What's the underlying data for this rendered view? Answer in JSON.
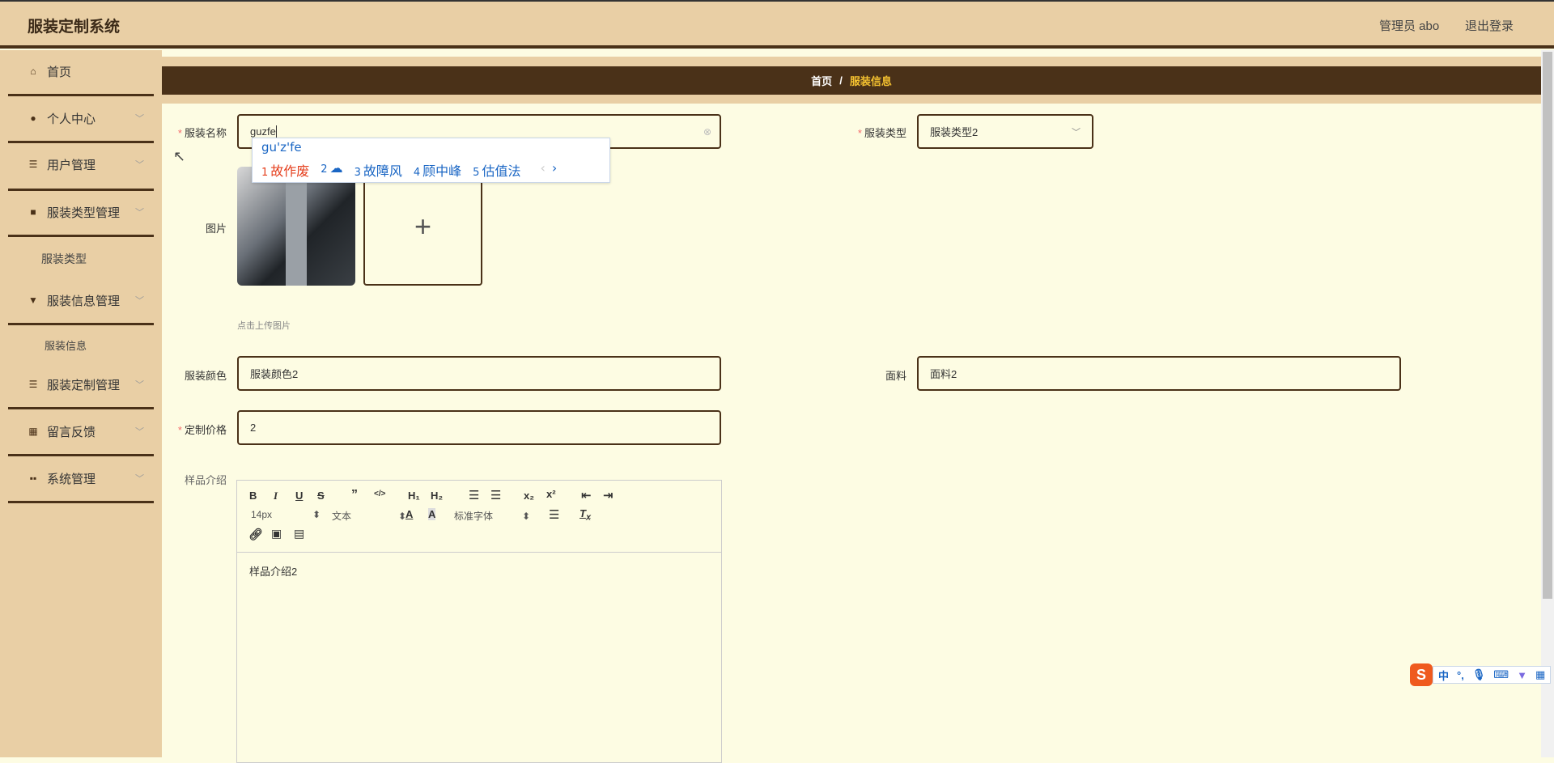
{
  "header": {
    "title": "服装定制系统",
    "user": "管理员 abo",
    "logout": "退出登录"
  },
  "sidebar": {
    "items": [
      {
        "label": "首页",
        "icon": "home-icon"
      },
      {
        "label": "个人中心",
        "icon": "user-icon"
      },
      {
        "label": "用户管理",
        "icon": "sliders-icon"
      },
      {
        "label": "服装类型管理",
        "icon": "briefcase-icon"
      },
      {
        "label": "服装信息管理",
        "icon": "pin-icon"
      },
      {
        "label": "服装定制管理",
        "icon": "list-icon"
      },
      {
        "label": "留言反馈",
        "icon": "grid-icon"
      },
      {
        "label": "系统管理",
        "icon": "apps-icon"
      }
    ],
    "sub_type": "服装类型",
    "sub_info": "服装信息"
  },
  "breadcrumb": {
    "home": "首页",
    "sep": "/",
    "current": "服装信息"
  },
  "form": {
    "name_label": "服装名称",
    "name_value": "guzfe",
    "type_label": "服装类型",
    "type_value": "服装类型2",
    "image_label": "图片",
    "upload_hint": "点击上传图片",
    "color_label": "服装颜色",
    "color_value": "服装颜色2",
    "fabric_label": "面料",
    "fabric_value": "面料2",
    "price_label": "定制价格",
    "price_value": "2",
    "intro_label": "样品介绍",
    "intro_value": "样品介绍2"
  },
  "editor": {
    "font_size": "14px",
    "block": "文本",
    "font": "标准字体"
  },
  "ime": {
    "composition": "gu'z'fe",
    "candidates": [
      {
        "n": "1",
        "t": "故作废"
      },
      {
        "n": "2",
        "t": "☁"
      },
      {
        "n": "3",
        "t": "故障风"
      },
      {
        "n": "4",
        "t": "顾中峰"
      },
      {
        "n": "5",
        "t": "估值法"
      }
    ]
  },
  "sogou": {
    "mode": "中",
    "punct": "°,"
  }
}
